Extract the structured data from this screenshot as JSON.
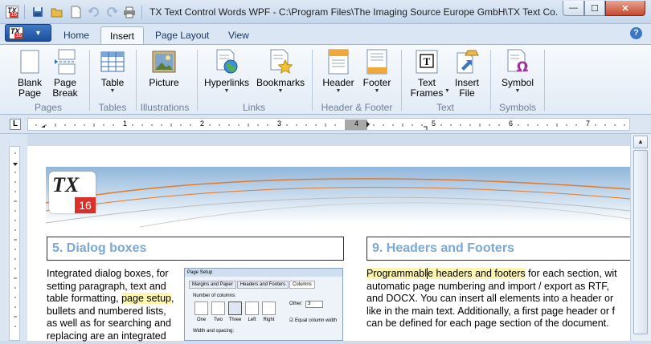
{
  "window": {
    "title": "TX Text Control Words WPF - C:\\Program Files\\The Imaging Source Europe GmbH\\TX Text Co...",
    "app_icon_text": "TX",
    "app_icon_number": "16",
    "controls": {
      "minimize": "—",
      "maximize": "☐",
      "close": "✕"
    }
  },
  "quick_access": [
    "save-icon",
    "open-icon",
    "new-icon",
    "undo-icon",
    "redo-icon",
    "print-icon"
  ],
  "tabs": [
    {
      "label": "Home",
      "active": false
    },
    {
      "label": "Insert",
      "active": true
    },
    {
      "label": "Page Layout",
      "active": false
    },
    {
      "label": "View",
      "active": false
    }
  ],
  "help": "?",
  "ribbon": {
    "groups": [
      {
        "name": "Pages",
        "buttons": [
          {
            "label": "Blank\nPage"
          },
          {
            "label": "Page\nBreak"
          }
        ]
      },
      {
        "name": "Tables",
        "buttons": [
          {
            "label": "Table"
          }
        ]
      },
      {
        "name": "Illustrations",
        "buttons": [
          {
            "label": "Picture"
          }
        ]
      },
      {
        "name": "Links",
        "buttons": [
          {
            "label": "Hyperlinks"
          },
          {
            "label": "Bookmarks"
          }
        ]
      },
      {
        "name": "Header & Footer",
        "buttons": [
          {
            "label": "Header"
          },
          {
            "label": "Footer"
          }
        ]
      },
      {
        "name": "Text",
        "buttons": [
          {
            "label": "Text\nFrames"
          },
          {
            "label": "Insert\nFile"
          }
        ]
      },
      {
        "name": "Symbols",
        "buttons": [
          {
            "label": "Symbol"
          }
        ]
      }
    ]
  },
  "ruler": {
    "numbers": [
      "1",
      "2",
      "3",
      "4",
      "5",
      "6",
      "7"
    ],
    "tab_selector": "L"
  },
  "document": {
    "logo": {
      "text": "TX",
      "number": "16"
    },
    "section5": {
      "heading": "5.  Dialog boxes",
      "lines": [
        "Integrated dialog boxes, for",
        "setting paragraph, text and",
        "table formatting, ",
        "page setup",
        ",",
        "bullets and numbered lists,",
        "as well as for searching and",
        "replacing are an integrated"
      ],
      "dialog": {
        "title": "Page Setup",
        "tabs": [
          "Margins and Paper",
          "Headers and Footers",
          "Columns"
        ],
        "number_label": "Number of columns:",
        "options": [
          "One",
          "Two",
          "Three",
          "Left",
          "Right"
        ],
        "other_label": "Other:",
        "other_value": "3",
        "equal_label": "Equal column width",
        "width_label": "Width and spacing:"
      }
    },
    "section9": {
      "heading": "9.  Headers and Footers",
      "highlight_a": "Programmabl",
      "highlight_b": "e headers and footers",
      "rest1": " for each section, wit",
      "lines": [
        "automatic page numbering and import / export as RTF,",
        "and DOCX. You can insert all elements into a header or",
        "like in the main text. Additionally, a first page header or f",
        "can be defined for each page section of the document."
      ]
    }
  }
}
